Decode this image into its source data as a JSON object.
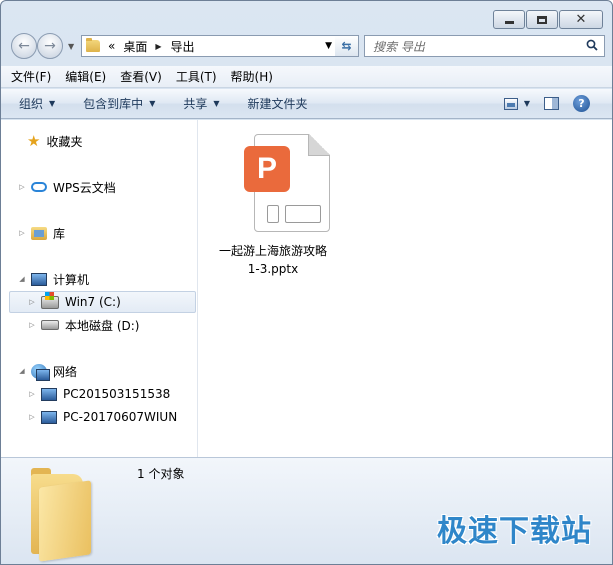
{
  "window": {
    "caption_buttons": {
      "minimize": "",
      "maximize": "",
      "close": "✕"
    }
  },
  "address": {
    "overflow": "«",
    "crumbs": [
      "桌面",
      "导出"
    ]
  },
  "search": {
    "placeholder": "搜索 导出"
  },
  "menubar": [
    "文件(F)",
    "编辑(E)",
    "查看(V)",
    "工具(T)",
    "帮助(H)"
  ],
  "commandbar": {
    "organize": "组织",
    "include_library": "包含到库中",
    "share": "共享",
    "new_folder": "新建文件夹"
  },
  "navpane": {
    "favorites": "收藏夹",
    "wps_cloud": "WPS云文档",
    "libraries": "库",
    "computer": "计算机",
    "drive_c": "Win7 (C:)",
    "drive_d": "本地磁盘 (D:)",
    "network": "网络",
    "pc1": "PC201503151538",
    "pc2": "PC-20170607WIUN"
  },
  "files": [
    {
      "name_line1": "一起游上海旅游攻略",
      "name_line2": "1-3.pptx",
      "badge": "P"
    }
  ],
  "details": {
    "count": "1 个对象"
  },
  "watermark": "极速下载站",
  "icons": {
    "back": "back-arrow-icon",
    "forward": "forward-arrow-icon",
    "refresh": "refresh-icon",
    "search": "search-icon",
    "help": "help-icon"
  },
  "colors": {
    "accent": "#2f86c9",
    "ppt": "#ea6a3c"
  }
}
